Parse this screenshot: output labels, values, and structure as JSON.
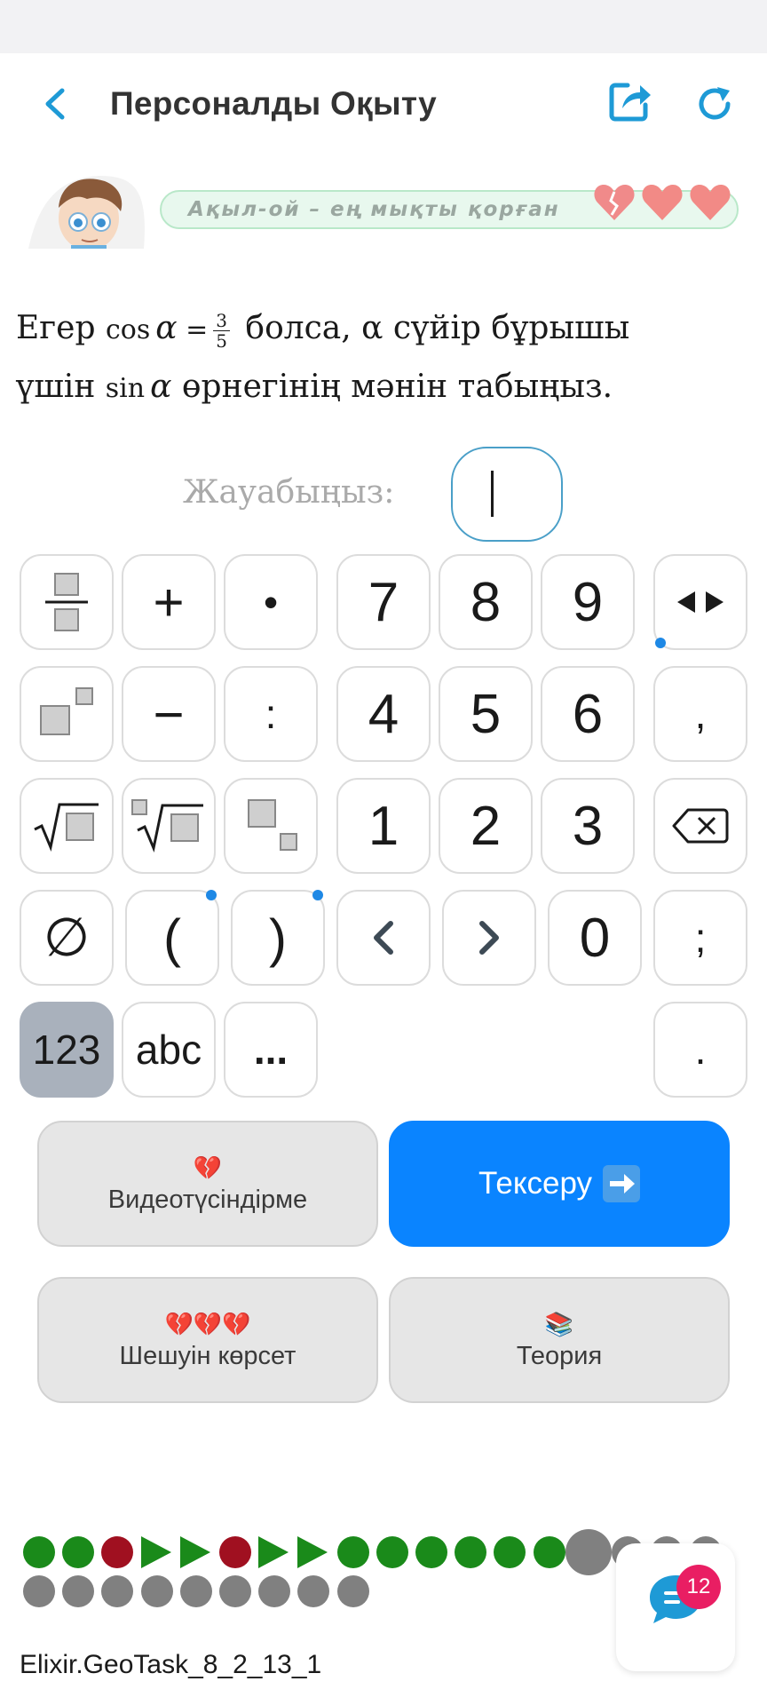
{
  "header": {
    "title": "Персоналды Оқыту",
    "icons": {
      "back": "chevron-left-icon",
      "share": "share-icon",
      "refresh": "refresh-icon"
    },
    "accent": "#1e9ad6"
  },
  "banner": {
    "motto": "Ақыл-ой – ең мықты қорған",
    "hearts": [
      "broken-heart",
      "heart",
      "heart"
    ]
  },
  "question": {
    "prefix": "Егер",
    "cos_func": "cos",
    "alpha": "α",
    "equals": "=",
    "frac_num": "3",
    "frac_den": "5",
    "middle": "болса, α сүйір бұрышы",
    "line2_prefix": "үшін",
    "sin_func": "sin",
    "suffix": "өрнегінің мәнін табыңыз."
  },
  "answer": {
    "label": "Жауабыңыз:",
    "value": ""
  },
  "keypad": {
    "row1": [
      "fraction",
      "+",
      "•",
      "7",
      "8",
      "9",
      "<>"
    ],
    "row2": [
      "superscript",
      "−",
      ":",
      "4",
      "5",
      "6",
      ","
    ],
    "row3": [
      "sqrt",
      "nth-root",
      "subscript",
      "1",
      "2",
      "3",
      "backspace"
    ],
    "row4": [
      "∅",
      "(",
      ")",
      "<",
      ">",
      "0",
      ";"
    ],
    "row5": [
      "123",
      "abc",
      "...",
      "."
    ],
    "labels": {
      "plus": "+",
      "dot": "•",
      "minus": "−",
      "colon": ":",
      "comma": ",",
      "empty_set": "∅",
      "paren_open": "(",
      "paren_close": ")",
      "zero": "0",
      "semicolon": ";",
      "k1": "1",
      "k2": "2",
      "k3": "3",
      "k4": "4",
      "k5": "5",
      "k6": "6",
      "k7": "7",
      "k8": "8",
      "k9": "9",
      "mode_numbers": "123",
      "mode_letters": "abc",
      "more": "...",
      "period": "."
    }
  },
  "actions": {
    "video": {
      "label": "Видеотүсіндірме",
      "emoji": "💔"
    },
    "check": {
      "label": "Тексеру",
      "emoji": "➡️"
    },
    "solution": {
      "label": "Шешуін көрсет",
      "emoji": "💔💔💔"
    },
    "theory": {
      "label": "Теория",
      "emoji": "📚"
    }
  },
  "progress": {
    "row1": [
      "green",
      "green",
      "red",
      "green-triangle",
      "green-triangle",
      "red",
      "green-triangle",
      "green-triangle",
      "green",
      "green",
      "green",
      "green",
      "green",
      "green",
      "gray-large",
      "gray",
      "gray",
      "gray"
    ],
    "row2": [
      "gray",
      "gray",
      "gray",
      "gray",
      "gray",
      "gray",
      "gray",
      "gray",
      "gray"
    ],
    "colors": {
      "green": "#1a8a1a",
      "red": "#a01020",
      "gray": "#808080"
    }
  },
  "chat": {
    "badge_count": "12"
  },
  "task_id": "Elixir.GeoTask_8_2_13_1"
}
